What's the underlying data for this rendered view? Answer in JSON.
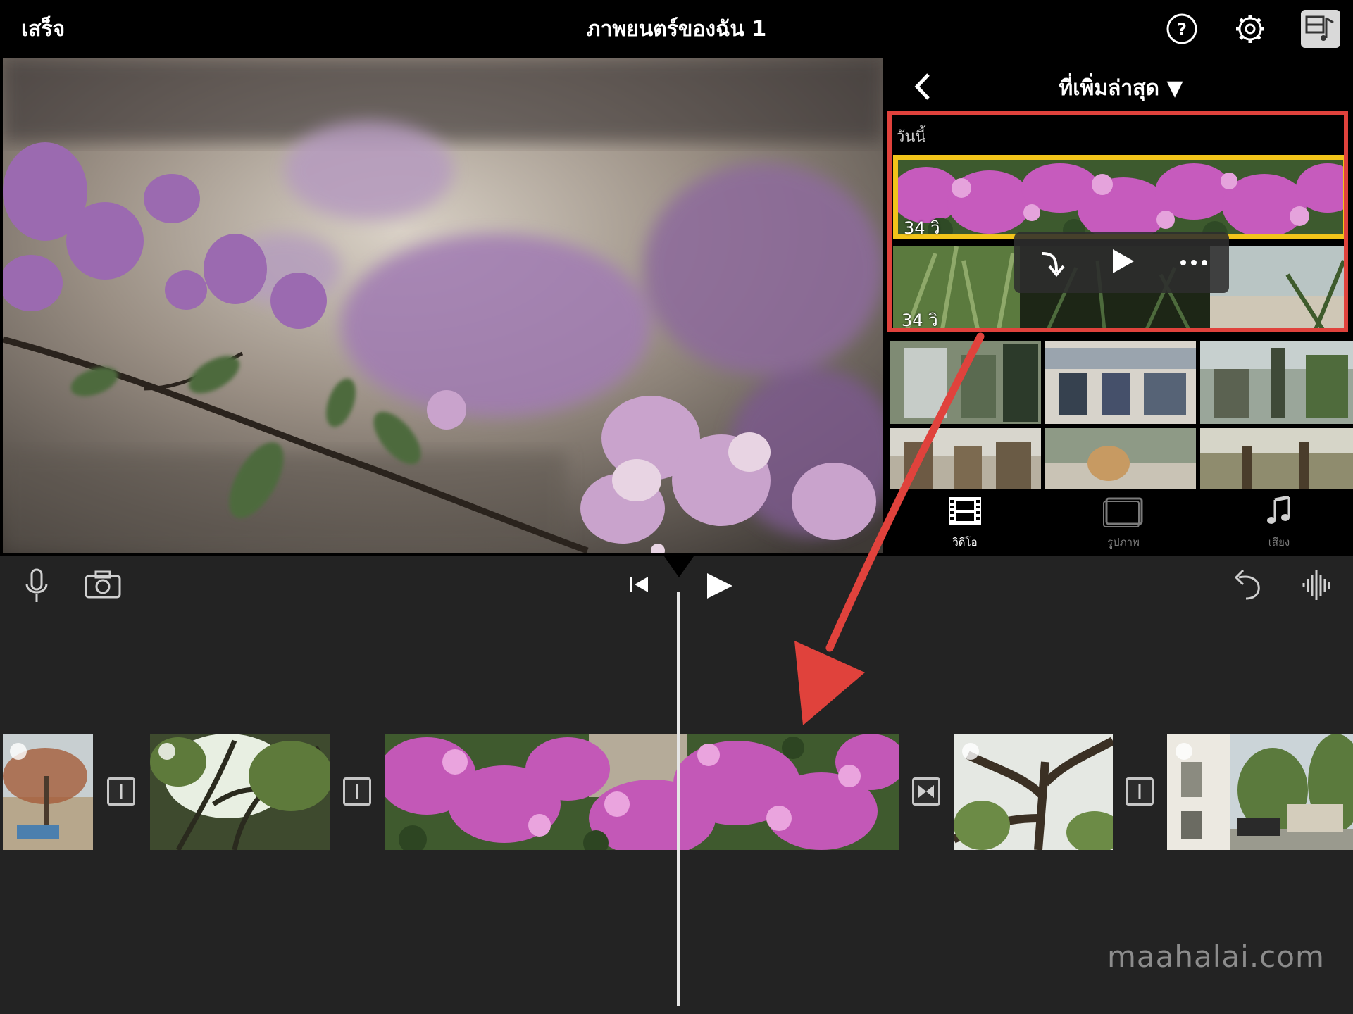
{
  "topbar": {
    "done_label": "เสร็จ",
    "project_title": "ภาพยนตร์ของฉัน 1",
    "icons": [
      "help-icon",
      "settings-icon",
      "media-library-toggle-icon"
    ]
  },
  "browser": {
    "filter_label": "ที่เพิ่มล่าสุด ▼",
    "section_label": "วันนี้",
    "clips": [
      {
        "duration": "34 วิ",
        "selected": true
      },
      {
        "duration": "34 วิ",
        "selected": false
      }
    ],
    "clip_actions": [
      "add-to-project-icon",
      "play-icon",
      "more-icon"
    ],
    "tabs": [
      {
        "label": "วิดีโอ",
        "icon": "film-icon",
        "active": true
      },
      {
        "label": "รูปภาพ",
        "icon": "photo-icon",
        "active": false
      },
      {
        "label": "เสียง",
        "icon": "music-note-icon",
        "active": false
      }
    ]
  },
  "timeline": {
    "controls_left": [
      "microphone-icon",
      "camera-icon"
    ],
    "controls_center": [
      "skip-to-start-icon",
      "play-icon"
    ],
    "controls_right": [
      "undo-icon",
      "audio-waveform-icon"
    ]
  },
  "watermark": "maahalai.com",
  "colors": {
    "highlight": "#e0423c",
    "selection": "#f2c41a",
    "timeline_bg": "#232323"
  }
}
